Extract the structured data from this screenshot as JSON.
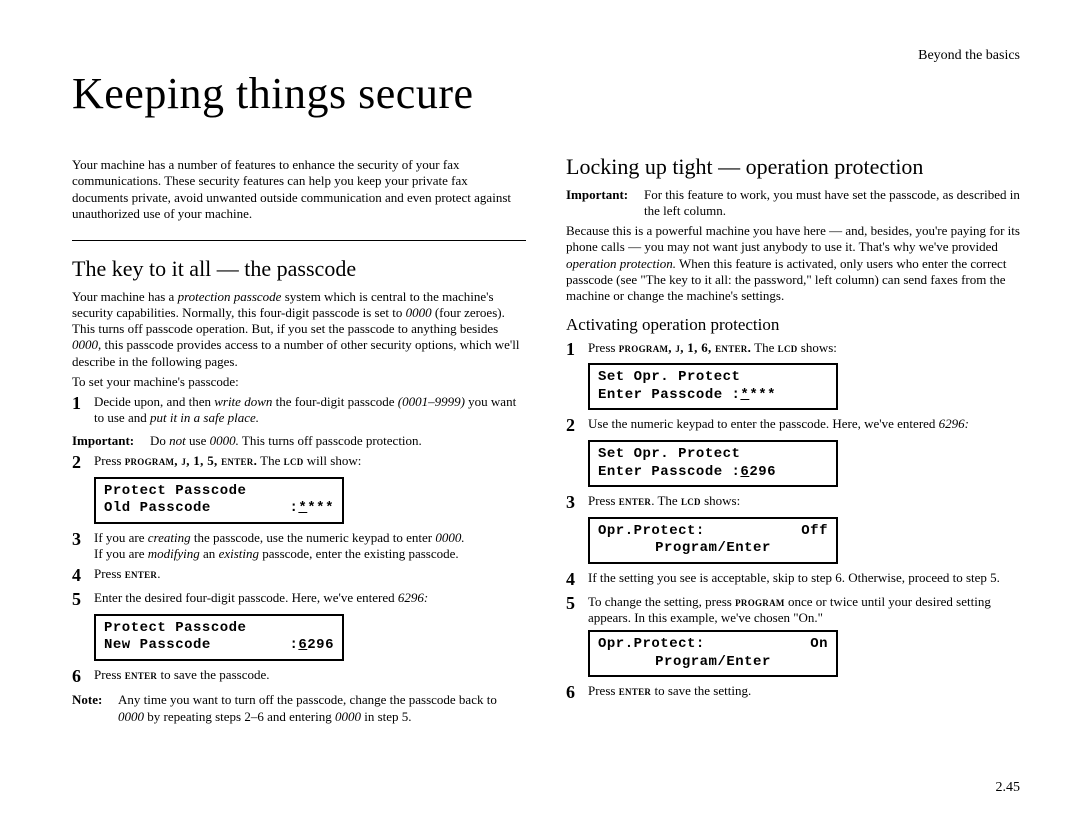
{
  "header": {
    "running": "Beyond the basics",
    "title": "Keeping things secure",
    "page_number": "2.45"
  },
  "intro": "Your machine has a number of features to enhance the security of your fax communications. These security features can help you keep your private fax documents private, avoid unwanted outside communication and even protect against unauthorized use of your machine.",
  "left": {
    "section": "The key to it all — the passcode",
    "p1a": "Your machine has a ",
    "p1b": "protection passcode",
    "p1c": " system which is central to the machine's security capabilities. Normally, this four-digit passcode is set to ",
    "p1d": "0000",
    "p1e": " (four zeroes). This turns off passcode operation. But, if you set the passcode to anything besides ",
    "p1f": "0000",
    "p1g": ", this passcode provides access to a number of other security options, which we'll describe in the following pages.",
    "set_prompt": "To set your machine's passcode:",
    "s1a": "Decide upon, and then ",
    "s1b": "write down",
    "s1c": " the four-digit passcode ",
    "s1d": "(0001–9999)",
    "s1e": " you want to use and ",
    "s1f": "put it in a safe place.",
    "imp_label": "Important:",
    "imp_a": "Do ",
    "imp_b": "not",
    "imp_c": " use ",
    "imp_d": "0000.",
    "imp_e": " This turns off passcode protection.",
    "s2a": "Press ",
    "s2b": "program, j, 1, 5, enter.",
    "s2c": " The ",
    "s2d": "lcd",
    "s2e": " will show:",
    "lcd1": {
      "l1": "Protect Passcode",
      "l2a": "Old Passcode",
      "l2b": ":",
      "l2c": "*",
      "l2d": "***"
    },
    "s3a": "If you are ",
    "s3b": "creating",
    "s3c": " the passcode, use the numeric keypad to enter ",
    "s3d": "0000.",
    "s3e": "If you are ",
    "s3f": "modifying",
    "s3g": " an ",
    "s3h": "existing",
    "s3i": " passcode, enter the existing passcode.",
    "s4a": "Press ",
    "s4b": "enter",
    "s4c": ".",
    "s5a": "Enter the desired four-digit passcode. Here, we've entered ",
    "s5b": "6296:",
    "lcd2": {
      "l1": "Protect Passcode",
      "l2a": "New Passcode",
      "l2b": ":",
      "l2c": "6",
      "l2d": "296"
    },
    "s6a": "Press ",
    "s6b": "enter",
    "s6c": " to save the passcode.",
    "note_label": "Note:",
    "note_a": "Any time you want to turn off the passcode, change the passcode back to ",
    "note_b": "0000",
    "note_c": " by repeating steps 2–6 and entering ",
    "note_d": "0000",
    "note_e": " in step 5."
  },
  "right": {
    "section": "Locking up tight — operation protection",
    "imp_label": "Important:",
    "imp_text": "For this feature to work, you must have set the passcode, as described in the left column.",
    "p1a": "Because this is a powerful machine you have here — and, besides, you're paying for its phone calls — you may not want just anybody to use it. That's why we've provided ",
    "p1b": "operation protection.",
    "p1c": " When this feature is activated, only users who enter the correct passcode (see \"The key to it all: the password,\" left column) can send faxes from the machine or change the machine's settings.",
    "subsection": "Activating operation protection",
    "s1a": "Press ",
    "s1b": "program, j, 1, 6, enter.",
    "s1c": " The ",
    "s1d": "lcd",
    "s1e": " shows:",
    "lcd1": {
      "l1": "Set Opr. Protect",
      "l2a": "Enter Passcode :",
      "l2b": "*",
      "l2c": "***"
    },
    "s2a": "Use the numeric keypad to enter the passcode. Here, we've entered ",
    "s2b": "6296:",
    "lcd2": {
      "l1": "Set Opr. Protect",
      "l2a": "Enter Passcode :",
      "l2b": "6",
      "l2c": "296"
    },
    "s3a": "Press ",
    "s3b": "enter",
    "s3c": ". The ",
    "s3d": "lcd",
    "s3e": " shows:",
    "lcd3": {
      "l1a": "Opr.Protect:",
      "l1b": "Off",
      "l2": "Program/Enter"
    },
    "s4": "If the setting you see is acceptable, skip to step 6. Otherwise, proceed to step 5.",
    "s5a": "To change the setting, press ",
    "s5b": "program",
    "s5c": " once or twice until your desired setting appears. In this example, we've chosen \"On.\"",
    "lcd4": {
      "l1a": "Opr.Protect:",
      "l1b": "On",
      "l2": "Program/Enter"
    },
    "s6a": "Press ",
    "s6b": "enter",
    "s6c": " to save the setting."
  }
}
